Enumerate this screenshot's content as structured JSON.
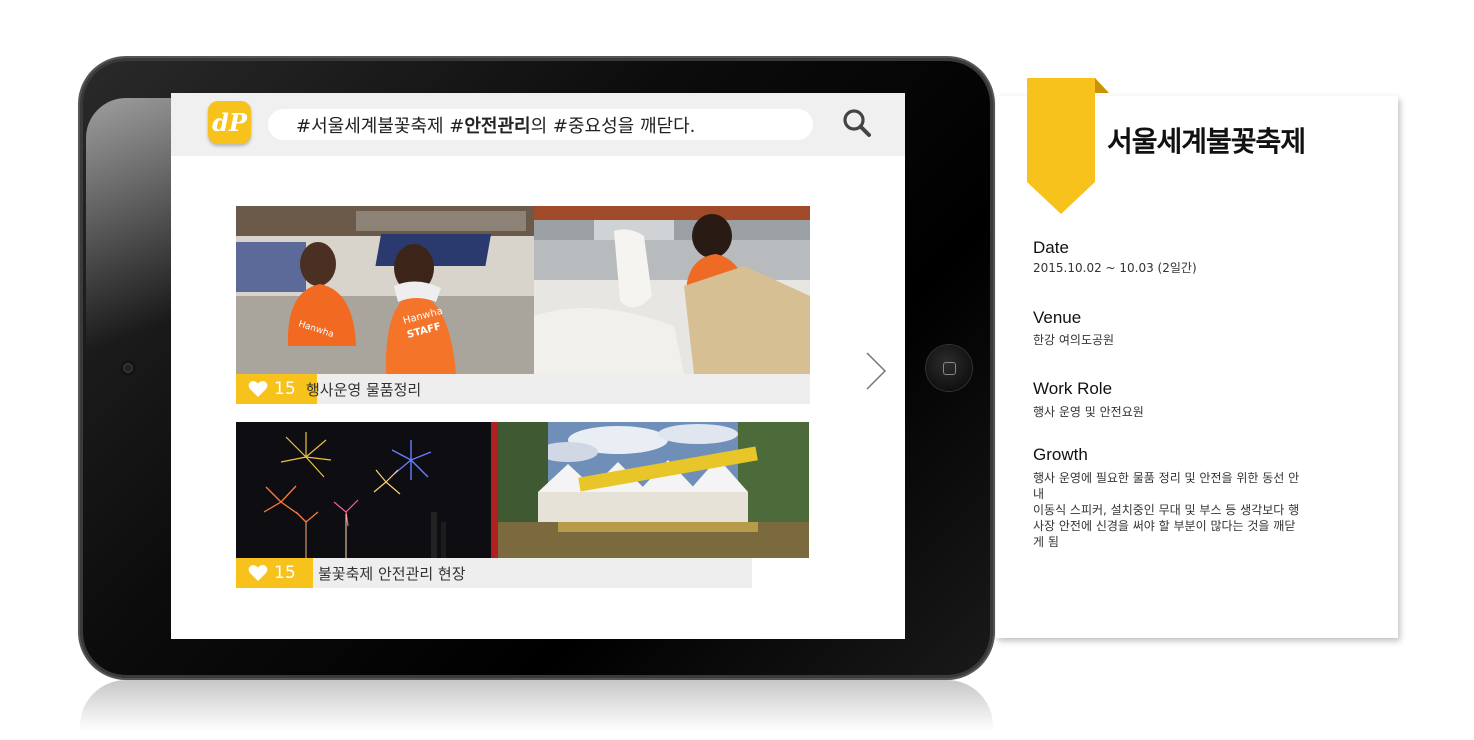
{
  "search": {
    "prefix": "#서울세계불꽃축제 #",
    "bold": "안전관리",
    "suffix": "의 #중요성을 깨닫다."
  },
  "app": {
    "logo_text": "dP"
  },
  "cards": [
    {
      "likes": "15",
      "caption": "행사운영 물품정리"
    },
    {
      "likes": "15",
      "caption": "불꽃축제 안전관리 현장"
    }
  ],
  "panel": {
    "title": "서울세계불꽃축제",
    "date_label": "Date",
    "date_value": "2015.10.02 ~ 10.03 (2일간)",
    "venue_label": "Venue",
    "venue_value": "한강 여의도공원",
    "role_label": "Work Role",
    "role_value": "행사 운영 및 안전요원",
    "growth_label": "Growth",
    "growth_lines": [
      "행사 운영에 필요한 물품 정리 및 안전을 위한 동선 안",
      "내",
      "이동식 스피커, 설치중인 무대 및 부스 등 생각보다 행",
      "사장 안전에 신경을 써야 할 부분이 많다는 것을 깨닫",
      "게 됨"
    ]
  },
  "colors": {
    "accent": "#f7c21b",
    "footer_bg": "#eeeeee",
    "topbar_bg": "#f0f0f0"
  },
  "icons": [
    "search-icon",
    "heart-icon",
    "chevron-right-icon",
    "home-button-icon",
    "bookmark-ribbon-icon"
  ]
}
